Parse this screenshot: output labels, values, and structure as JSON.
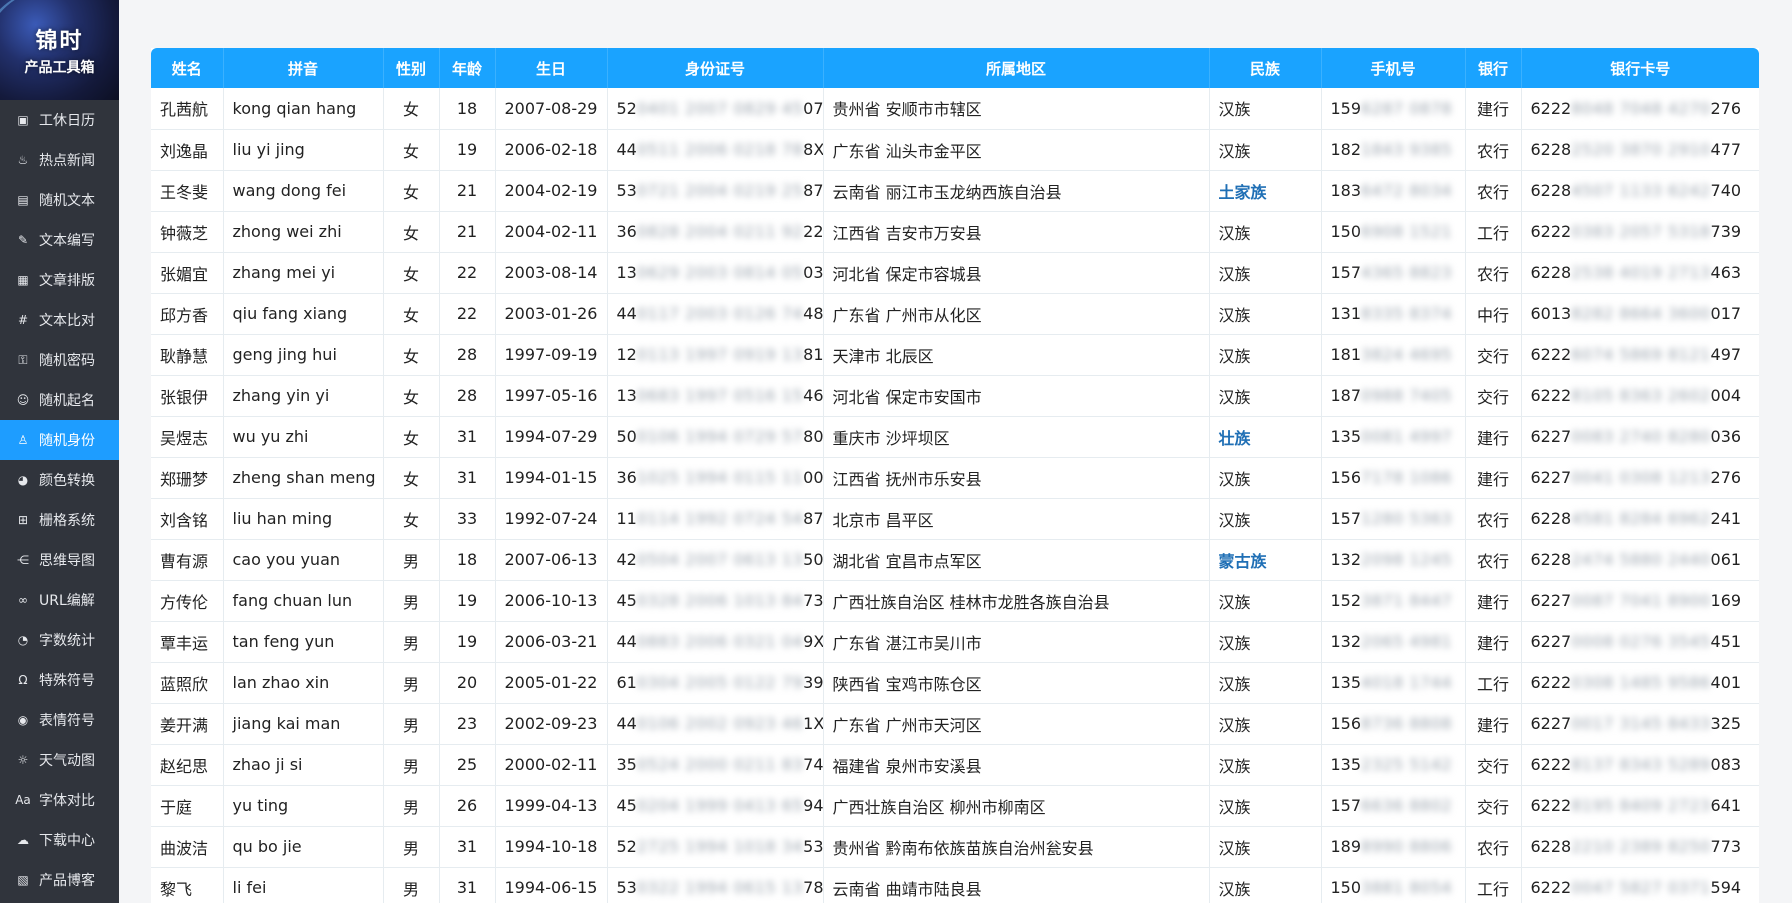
{
  "app": {
    "logo_title": "锦时",
    "logo_sub": "产品工具箱"
  },
  "sidebar": {
    "items": [
      {
        "label": "工休日历",
        "icon": "calendar-icon",
        "glyph": "▣",
        "active": false
      },
      {
        "label": "热点新闻",
        "icon": "flame-icon",
        "glyph": "♨",
        "active": false
      },
      {
        "label": "随机文本",
        "icon": "document-icon",
        "glyph": "▤",
        "active": false
      },
      {
        "label": "文本编写",
        "icon": "pen-icon",
        "glyph": "✎",
        "active": false
      },
      {
        "label": "文章排版",
        "icon": "layout-icon",
        "glyph": "▦",
        "active": false
      },
      {
        "label": "文本比对",
        "icon": "hash-icon",
        "glyph": "#",
        "active": false
      },
      {
        "label": "随机密码",
        "icon": "key-icon",
        "glyph": "⚿",
        "active": false
      },
      {
        "label": "随机起名",
        "icon": "smile-icon",
        "glyph": "☺",
        "active": false
      },
      {
        "label": "随机身份",
        "icon": "user-id-icon",
        "glyph": "♙",
        "active": true
      },
      {
        "label": "颜色转换",
        "icon": "palette-icon",
        "glyph": "◕",
        "active": false
      },
      {
        "label": "栅格系统",
        "icon": "grid-icon",
        "glyph": "⊞",
        "active": false
      },
      {
        "label": "思维导图",
        "icon": "mindmap-icon",
        "glyph": "⋲",
        "active": false
      },
      {
        "label": "URL编解",
        "icon": "link-icon",
        "glyph": "∞",
        "active": false
      },
      {
        "label": "字数统计",
        "icon": "chart-icon",
        "glyph": "◔",
        "active": false
      },
      {
        "label": "特殊符号",
        "icon": "omega-icon",
        "glyph": "Ω",
        "active": false
      },
      {
        "label": "表情符号",
        "icon": "emoji-icon",
        "glyph": "◉",
        "active": false
      },
      {
        "label": "天气动图",
        "icon": "sun-icon",
        "glyph": "☼",
        "active": false
      },
      {
        "label": "字体对比",
        "icon": "font-icon",
        "glyph": "Aa",
        "active": false
      },
      {
        "label": "下载中心",
        "icon": "cloud-download-icon",
        "glyph": "☁",
        "active": false
      },
      {
        "label": "产品博客",
        "icon": "blog-icon",
        "glyph": "▧",
        "active": false
      }
    ]
  },
  "table": {
    "headers": [
      "姓名",
      "拼音",
      "性别",
      "年龄",
      "生日",
      "身份证号",
      "所属地区",
      "民族",
      "手机号",
      "银行",
      "银行卡号"
    ],
    "rows": [
      {
        "name": "孔茜航",
        "pinyin": "kong qian hang",
        "gender": "女",
        "age": "18",
        "birthday": "2007-08-29",
        "id_prefix": "52",
        "id_mask": "0401 2007 0829 45",
        "id_suffix": "07",
        "region": "贵州省 安顺市市辖区",
        "nation": "汉族",
        "nation_minor": false,
        "phone_prefix": "159",
        "phone_mask": "6287 0878",
        "bank": "建行",
        "card_prefix": "6222",
        "card_mask": "8048 7048 4270",
        "card_suffix": "276"
      },
      {
        "name": "刘逸晶",
        "pinyin": "liu yi jing",
        "gender": "女",
        "age": "19",
        "birthday": "2006-02-18",
        "id_prefix": "44",
        "id_mask": "0511 2006 0218 78",
        "id_suffix": "8X",
        "region": "广东省 汕头市金平区",
        "nation": "汉族",
        "nation_minor": false,
        "phone_prefix": "182",
        "phone_mask": "1843 9385",
        "bank": "农行",
        "card_prefix": "6228",
        "card_mask": "2520 3870 2910",
        "card_suffix": "477"
      },
      {
        "name": "王冬斐",
        "pinyin": "wang dong fei",
        "gender": "女",
        "age": "21",
        "birthday": "2004-02-19",
        "id_prefix": "53",
        "id_mask": "0721 2004 0219 25",
        "id_suffix": "87",
        "region": "云南省 丽江市玉龙纳西族自治县",
        "nation": "土家族",
        "nation_minor": true,
        "phone_prefix": "183",
        "phone_mask": "6472 8034",
        "bank": "农行",
        "card_prefix": "6228",
        "card_mask": "4507 1133 6242",
        "card_suffix": "740"
      },
      {
        "name": "钟薇芝",
        "pinyin": "zhong wei zhi",
        "gender": "女",
        "age": "21",
        "birthday": "2004-02-11",
        "id_prefix": "36",
        "id_mask": "0828 2004 0211 92",
        "id_suffix": "22",
        "region": "江西省 吉安市万安县",
        "nation": "汉族",
        "nation_minor": false,
        "phone_prefix": "150",
        "phone_mask": "6908 1521",
        "bank": "工行",
        "card_prefix": "6222",
        "card_mask": "0383 2057 5318",
        "card_suffix": "739"
      },
      {
        "name": "张媚宜",
        "pinyin": "zhang mei yi",
        "gender": "女",
        "age": "22",
        "birthday": "2003-08-14",
        "id_prefix": "13",
        "id_mask": "0629 2003 0814 05",
        "id_suffix": "03",
        "region": "河北省 保定市容城县",
        "nation": "汉族",
        "nation_minor": false,
        "phone_prefix": "157",
        "phone_mask": "4365 8823",
        "bank": "农行",
        "card_prefix": "6228",
        "card_mask": "2538 4019 2713",
        "card_suffix": "463"
      },
      {
        "name": "邱方香",
        "pinyin": "qiu fang xiang",
        "gender": "女",
        "age": "22",
        "birthday": "2003-01-26",
        "id_prefix": "44",
        "id_mask": "0117 2003 0126 74",
        "id_suffix": "48",
        "region": "广东省 广州市从化区",
        "nation": "汉族",
        "nation_minor": false,
        "phone_prefix": "131",
        "phone_mask": "8335 8374",
        "bank": "中行",
        "card_prefix": "6013",
        "card_mask": "8282 8664 3600",
        "card_suffix": "017"
      },
      {
        "name": "耿静慧",
        "pinyin": "geng jing hui",
        "gender": "女",
        "age": "28",
        "birthday": "1997-09-19",
        "id_prefix": "12",
        "id_mask": "0113 1997 0919 13",
        "id_suffix": "81",
        "region": "天津市 北辰区",
        "nation": "汉族",
        "nation_minor": false,
        "phone_prefix": "181",
        "phone_mask": "3824 4695",
        "bank": "交行",
        "card_prefix": "6222",
        "card_mask": "6074 5869 8121",
        "card_suffix": "497"
      },
      {
        "name": "张银伊",
        "pinyin": "zhang yin yi",
        "gender": "女",
        "age": "28",
        "birthday": "1997-05-16",
        "id_prefix": "13",
        "id_mask": "0683 1997 0516 15",
        "id_suffix": "46",
        "region": "河北省 保定市安国市",
        "nation": "汉族",
        "nation_minor": false,
        "phone_prefix": "187",
        "phone_mask": "0988 7405",
        "bank": "交行",
        "card_prefix": "6222",
        "card_mask": "8105 8363 2602",
        "card_suffix": "004"
      },
      {
        "name": "吴煜志",
        "pinyin": "wu yu zhi",
        "gender": "女",
        "age": "31",
        "birthday": "1994-07-29",
        "id_prefix": "50",
        "id_mask": "0106 1994 0729 57",
        "id_suffix": "80",
        "region": "重庆市 沙坪坝区",
        "nation": "壮族",
        "nation_minor": true,
        "phone_prefix": "135",
        "phone_mask": "0081 4997",
        "bank": "建行",
        "card_prefix": "6227",
        "card_mask": "0083 2740 8280",
        "card_suffix": "036"
      },
      {
        "name": "郑珊梦",
        "pinyin": "zheng shan meng",
        "gender": "女",
        "age": "31",
        "birthday": "1994-01-15",
        "id_prefix": "36",
        "id_mask": "1025 1994 0115 11",
        "id_suffix": "00",
        "region": "江西省 抚州市乐安县",
        "nation": "汉族",
        "nation_minor": false,
        "phone_prefix": "156",
        "phone_mask": "7178 1086",
        "bank": "建行",
        "card_prefix": "6227",
        "card_mask": "0041 0308 1213",
        "card_suffix": "276"
      },
      {
        "name": "刘含铭",
        "pinyin": "liu han ming",
        "gender": "女",
        "age": "33",
        "birthday": "1992-07-24",
        "id_prefix": "11",
        "id_mask": "0114 1992 0724 54",
        "id_suffix": "87",
        "region": "北京市 昌平区",
        "nation": "汉族",
        "nation_minor": false,
        "phone_prefix": "157",
        "phone_mask": "1280 5363",
        "bank": "农行",
        "card_prefix": "6228",
        "card_mask": "4581 8284 6962",
        "card_suffix": "241"
      },
      {
        "name": "曹有源",
        "pinyin": "cao you yuan",
        "gender": "男",
        "age": "18",
        "birthday": "2007-06-13",
        "id_prefix": "42",
        "id_mask": "0504 2007 0613 13",
        "id_suffix": "50",
        "region": "湖北省 宜昌市点军区",
        "nation": "蒙古族",
        "nation_minor": true,
        "phone_prefix": "132",
        "phone_mask": "2098 1245",
        "bank": "农行",
        "card_prefix": "6228",
        "card_mask": "2474 5880 2440",
        "card_suffix": "061"
      },
      {
        "name": "方传伦",
        "pinyin": "fang chuan lun",
        "gender": "男",
        "age": "19",
        "birthday": "2006-10-13",
        "id_prefix": "45",
        "id_mask": "0328 2006 1013 84",
        "id_suffix": "73",
        "region": "广西壮族自治区 桂林市龙胜各族自治县",
        "nation": "汉族",
        "nation_minor": false,
        "phone_prefix": "152",
        "phone_mask": "3871 8447",
        "bank": "建行",
        "card_prefix": "6227",
        "card_mask": "0087 7041 8900",
        "card_suffix": "169"
      },
      {
        "name": "覃丰运",
        "pinyin": "tan feng yun",
        "gender": "男",
        "age": "19",
        "birthday": "2006-03-21",
        "id_prefix": "44",
        "id_mask": "0883 2006 0321 04",
        "id_suffix": "9X",
        "region": "广东省 湛江市吴川市",
        "nation": "汉族",
        "nation_minor": false,
        "phone_prefix": "132",
        "phone_mask": "2065 4981",
        "bank": "建行",
        "card_prefix": "6227",
        "card_mask": "0008 0276 3545",
        "card_suffix": "451"
      },
      {
        "name": "蓝照欣",
        "pinyin": "lan zhao xin",
        "gender": "男",
        "age": "20",
        "birthday": "2005-01-22",
        "id_prefix": "61",
        "id_mask": "0304 2005 0122 79",
        "id_suffix": "39",
        "region": "陕西省 宝鸡市陈仓区",
        "nation": "汉族",
        "nation_minor": false,
        "phone_prefix": "135",
        "phone_mask": "4018 1744",
        "bank": "工行",
        "card_prefix": "6222",
        "card_mask": "0308 1485 9586",
        "card_suffix": "401"
      },
      {
        "name": "姜开满",
        "pinyin": "jiang kai man",
        "gender": "男",
        "age": "23",
        "birthday": "2002-09-23",
        "id_prefix": "44",
        "id_mask": "0106 2002 0923 46",
        "id_suffix": "1X",
        "region": "广东省 广州市天河区",
        "nation": "汉族",
        "nation_minor": false,
        "phone_prefix": "156",
        "phone_mask": "8736 8808",
        "bank": "建行",
        "card_prefix": "6227",
        "card_mask": "0017 3145 8433",
        "card_suffix": "325"
      },
      {
        "name": "赵纪思",
        "pinyin": "zhao ji si",
        "gender": "男",
        "age": "25",
        "birthday": "2000-02-11",
        "id_prefix": "35",
        "id_mask": "0524 2000 0211 83",
        "id_suffix": "74",
        "region": "福建省 泉州市安溪县",
        "nation": "汉族",
        "nation_minor": false,
        "phone_prefix": "135",
        "phone_mask": "2325 5142",
        "bank": "交行",
        "card_prefix": "6222",
        "card_mask": "8137 8343 5289",
        "card_suffix": "083"
      },
      {
        "name": "于庭",
        "pinyin": "yu ting",
        "gender": "男",
        "age": "26",
        "birthday": "1999-04-13",
        "id_prefix": "45",
        "id_mask": "0204 1999 0413 65",
        "id_suffix": "94",
        "region": "广西壮族自治区 柳州市柳南区",
        "nation": "汉族",
        "nation_minor": false,
        "phone_prefix": "157",
        "phone_mask": "6636 8802",
        "bank": "交行",
        "card_prefix": "6222",
        "card_mask": "8195 8409 2723",
        "card_suffix": "641"
      },
      {
        "name": "曲波洁",
        "pinyin": "qu bo jie",
        "gender": "男",
        "age": "31",
        "birthday": "1994-10-18",
        "id_prefix": "52",
        "id_mask": "2725 1994 1018 34",
        "id_suffix": "53",
        "region": "贵州省 黔南布依族苗族自治州瓮安县",
        "nation": "汉族",
        "nation_minor": false,
        "phone_prefix": "189",
        "phone_mask": "8990 8806",
        "bank": "农行",
        "card_prefix": "6228",
        "card_mask": "2210 2389 8250",
        "card_suffix": "773"
      },
      {
        "name": "黎飞",
        "pinyin": "li fei",
        "gender": "男",
        "age": "31",
        "birthday": "1994-06-15",
        "id_prefix": "53",
        "id_mask": "0322 1994 0615 13",
        "id_suffix": "78",
        "region": "云南省 曲靖市陆良县",
        "nation": "汉族",
        "nation_minor": false,
        "phone_prefix": "150",
        "phone_mask": "3881 8054",
        "bank": "工行",
        "card_prefix": "6222",
        "card_mask": "0047 5827 0371",
        "card_suffix": "594"
      }
    ]
  }
}
